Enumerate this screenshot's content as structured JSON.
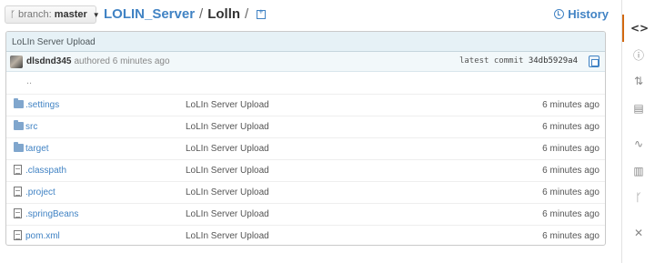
{
  "branch": {
    "icon": "branch-icon",
    "label": "branch:",
    "name": "master"
  },
  "breadcrumb": {
    "repo": "LOLIN_Server",
    "separator": "/",
    "current": "Lolln",
    "trailing_separator": "/"
  },
  "history": {
    "label": "History",
    "icon": "history-icon"
  },
  "commit": {
    "title": "LoLIn Server Upload",
    "author": "dlsdnd345",
    "authored": "authored 6 minutes ago",
    "latest_label": "latest commit",
    "sha": "34db5929a4"
  },
  "parent": "..",
  "files": [
    {
      "type": "folder",
      "name": ".settings",
      "message": "LoLIn Server Upload",
      "age": "6 minutes ago"
    },
    {
      "type": "folder",
      "name": "src",
      "message": "LoLIn Server Upload",
      "age": "6 minutes ago"
    },
    {
      "type": "folder",
      "name": "target",
      "message": "LoLIn Server Upload",
      "age": "6 minutes ago"
    },
    {
      "type": "file",
      "name": ".classpath",
      "message": "LoLIn Server Upload",
      "age": "6 minutes ago"
    },
    {
      "type": "file",
      "name": ".project",
      "message": "LoLIn Server Upload",
      "age": "6 minutes ago"
    },
    {
      "type": "file",
      "name": ".springBeans",
      "message": "LoLIn Server Upload",
      "age": "6 minutes ago"
    },
    {
      "type": "file",
      "name": "pom.xml",
      "message": "LoLIn Server Upload",
      "age": "6 minutes ago"
    }
  ],
  "sidebar": [
    {
      "name": "code-icon",
      "glyph": "<>",
      "active": true
    },
    {
      "name": "issues-icon",
      "glyph": "ⓘ",
      "active": false
    },
    {
      "name": "pull-requests-icon",
      "glyph": "⇅",
      "active": false
    },
    {
      "name": "wiki-icon",
      "glyph": "▤",
      "active": false
    },
    {
      "name": "pulse-icon",
      "glyph": "∿",
      "active": false
    },
    {
      "name": "graphs-icon",
      "glyph": "▥",
      "active": false
    },
    {
      "name": "network-icon",
      "glyph": "ᚴ",
      "active": false
    },
    {
      "name": "settings-icon",
      "glyph": "✕",
      "active": false
    }
  ],
  "colors": {
    "link": "#4183c4",
    "active_tab": "#d26911",
    "header_bg": "#e6f1f6"
  }
}
